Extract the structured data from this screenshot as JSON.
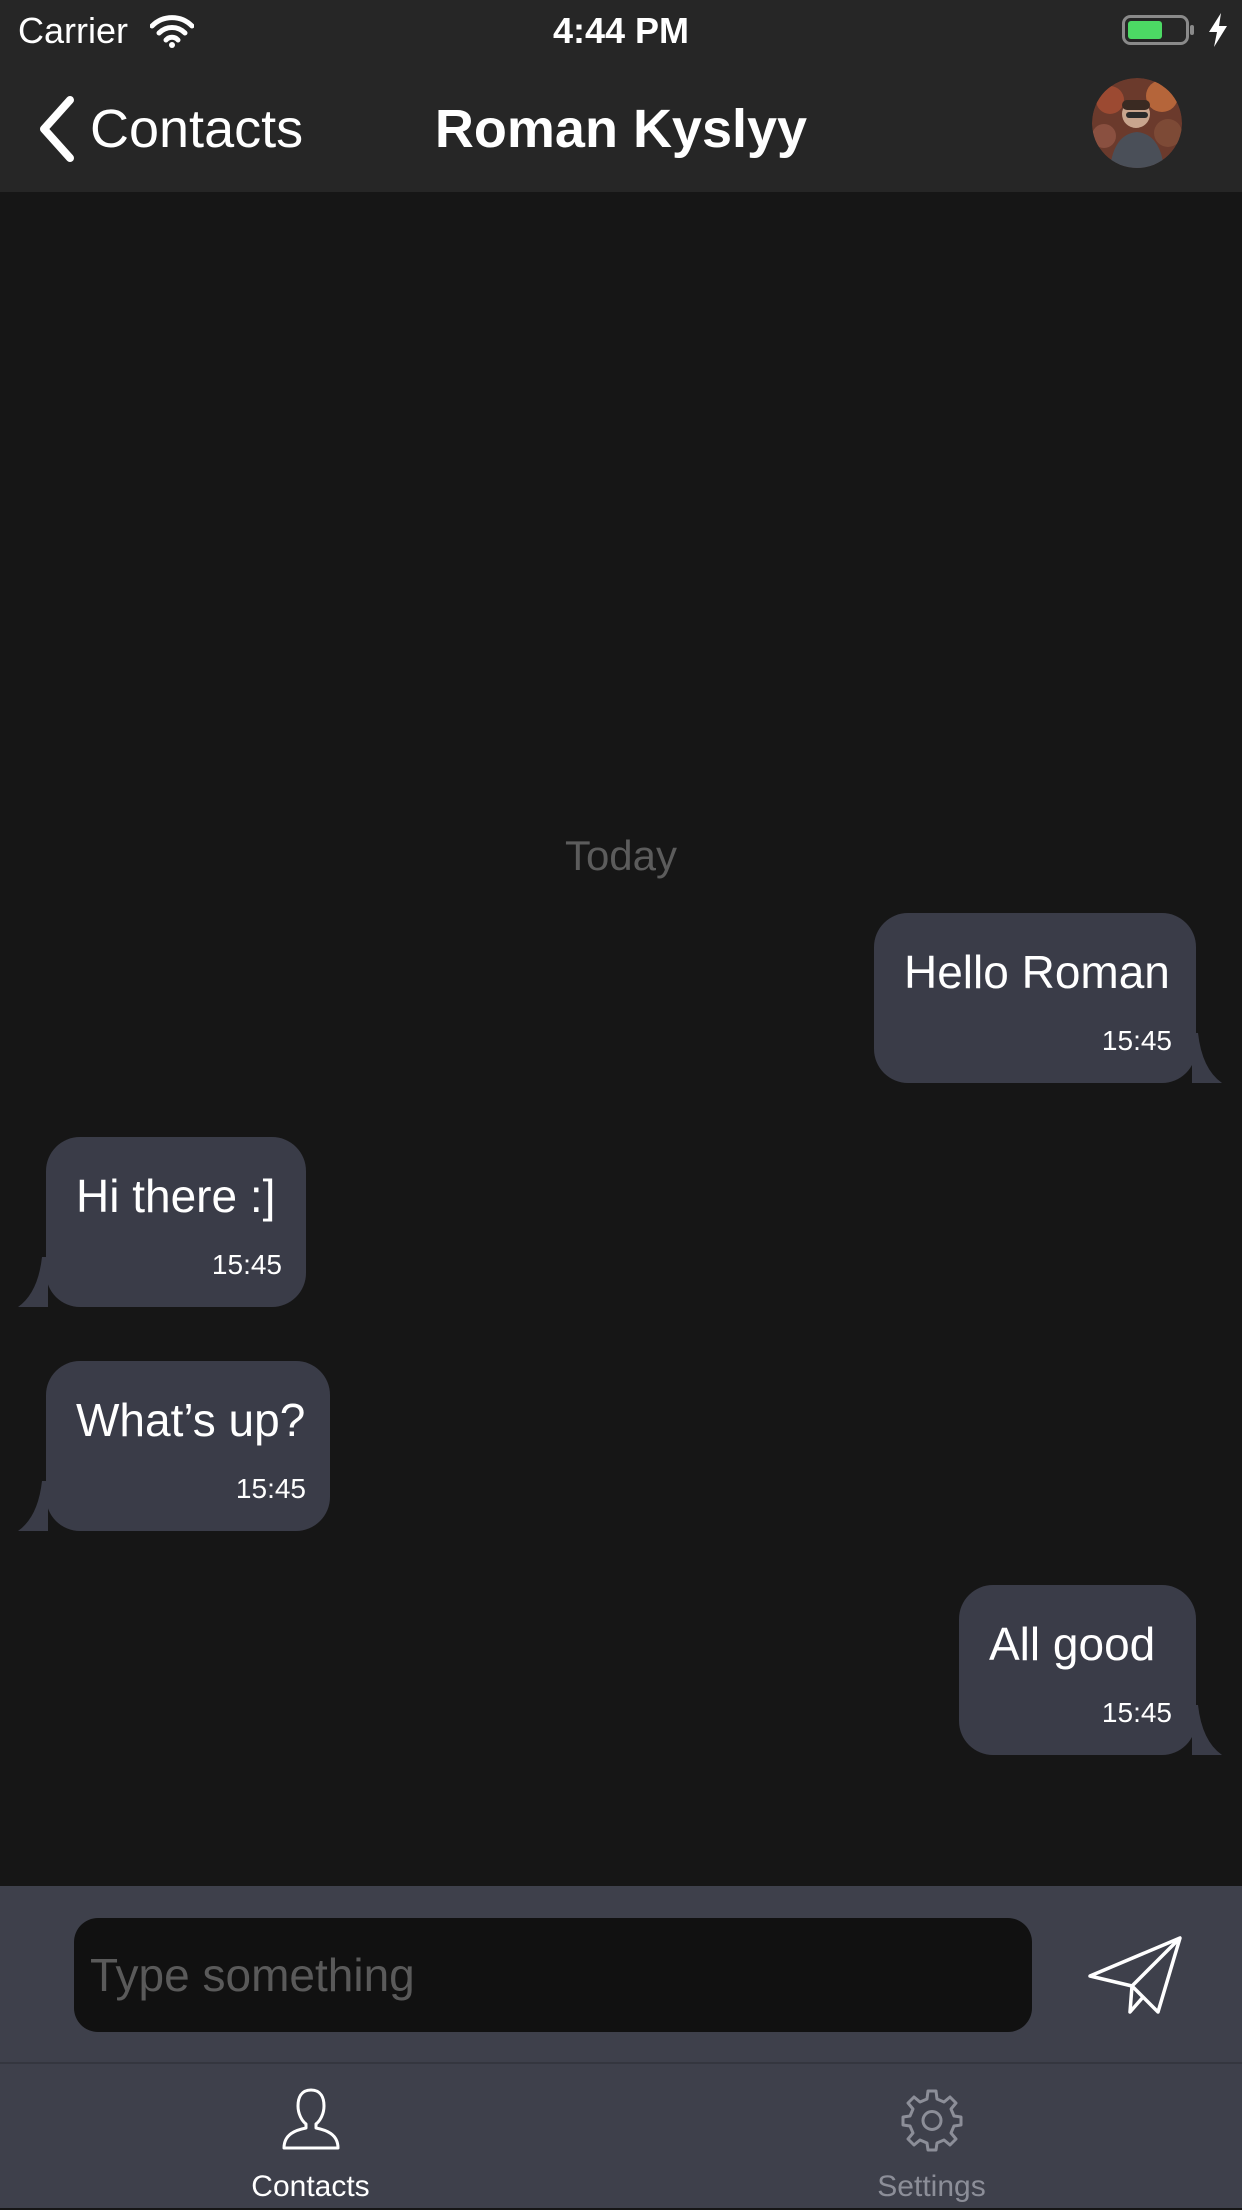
{
  "status_bar": {
    "carrier": "Carrier",
    "time": "4:44 PM",
    "battery_color": "#4cd964"
  },
  "nav": {
    "back_label": "Contacts",
    "title": "Roman Kyslyy"
  },
  "chat": {
    "day_label": "Today",
    "messages": [
      {
        "text": "Hello Roman",
        "time": "15:45",
        "direction": "outgoing"
      },
      {
        "text": "Hi there :]",
        "time": "15:45",
        "direction": "incoming"
      },
      {
        "text": "What’s up?",
        "time": "15:45",
        "direction": "incoming"
      },
      {
        "text": "All good",
        "time": "15:45",
        "direction": "outgoing"
      }
    ],
    "bubble_color": "#3a3c48"
  },
  "composer": {
    "placeholder": "Type something",
    "send_icon": "paper-plane-icon"
  },
  "tabs": [
    {
      "label": "Contacts",
      "icon": "person-icon",
      "active": true
    },
    {
      "label": "Settings",
      "icon": "gear-icon",
      "active": false
    }
  ],
  "colors": {
    "background": "#161616",
    "bar": "#262626",
    "input_bar": "#3e404b"
  }
}
